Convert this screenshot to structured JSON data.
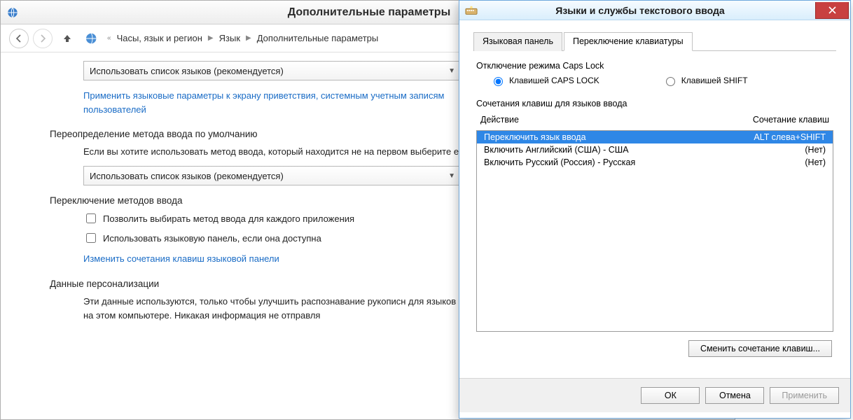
{
  "cp": {
    "title": "Дополнительные параметры",
    "breadcrumb": {
      "prefix": "«",
      "items": [
        "Часы, язык и регион",
        "Язык",
        "Дополнительные параметры"
      ]
    },
    "dropdown1": "Использовать список языков (рекомендуется)",
    "link_welcome": "Применить языковые параметры к экрану приветствия, системным учетным записям пользователей",
    "h_override": "Переопределение метода ввода по умолчанию",
    "p_override": "Если вы хотите использовать метод ввода, который находится не на первом выберите его здесь.",
    "dropdown2": "Использовать список языков (рекомендуется)",
    "h_switch": "Переключение методов ввода",
    "chk1_label": "Позволить выбирать метод ввода для каждого приложения",
    "chk2_label": "Использовать языковую панель, если она доступна",
    "link_hotkeys": "Изменить сочетания клавиш языковой панели",
    "h_personal": "Данные персонализации",
    "p_personal": "Эти данные используются, только чтобы улучшить распознавание рукописн для языков без IME на этом компьютере. Никакая информация не отправля"
  },
  "dlg": {
    "title": "Языки и службы текстового ввода",
    "tabs": [
      "Языковая панель",
      "Переключение клавиатуры"
    ],
    "caps_group": "Отключение режима Caps Lock",
    "radio_caps": "Клавишей CAPS LOCK",
    "radio_shift": "Клавишей SHIFT",
    "hotkey_group": "Сочетания клавиш для языков ввода",
    "col_action": "Действие",
    "col_keys": "Сочетание клавиш",
    "rows": [
      {
        "action": "Переключить язык ввода",
        "keys": "ALT слева+SHIFT",
        "selected": true
      },
      {
        "action": "Включить Английский (США) - США",
        "keys": "(Нет)",
        "selected": false
      },
      {
        "action": "Включить Русский (Россия) - Русская",
        "keys": "(Нет)",
        "selected": false
      }
    ],
    "btn_change": "Сменить сочетание клавиш...",
    "btn_ok": "ОК",
    "btn_cancel": "Отмена",
    "btn_apply": "Применить"
  }
}
